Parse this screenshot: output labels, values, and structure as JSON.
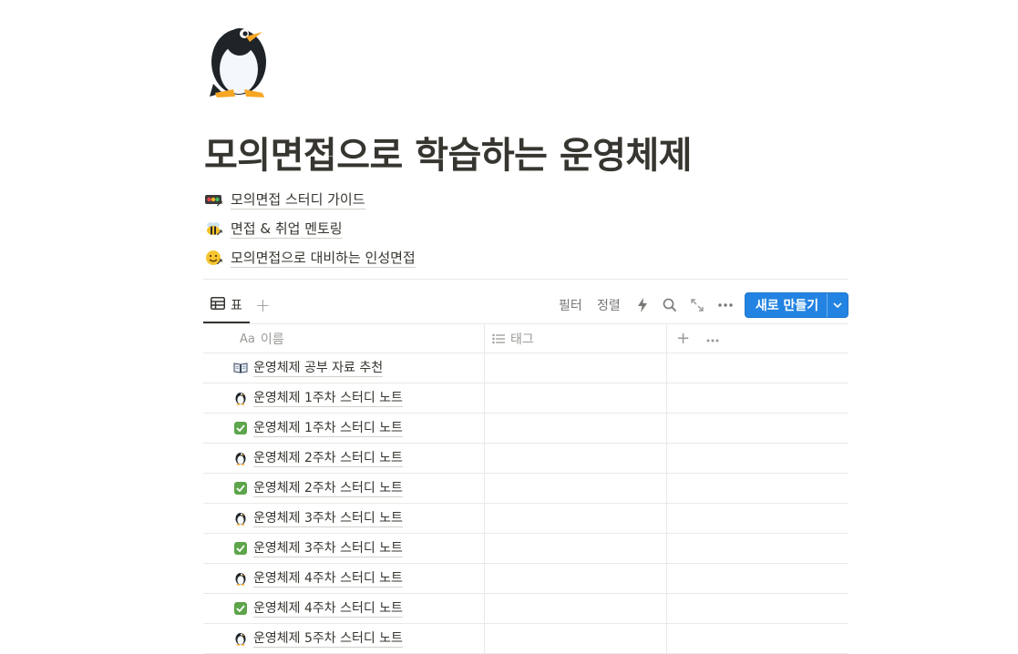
{
  "page": {
    "icon": "penguin-icon",
    "title": "모의면접으로 학습하는 운영체제"
  },
  "links": [
    {
      "icon": "traffic-light-icon",
      "label": "모의면접 스터디 가이드"
    },
    {
      "icon": "bee-icon",
      "label": "면접 & 취업 멘토링"
    },
    {
      "icon": "smile-face-icon",
      "label": "모의면접으로 대비하는 인성면접"
    }
  ],
  "toolbar": {
    "view_tab_label": "표",
    "filter_label": "필터",
    "sort_label": "정렬",
    "new_button_label": "새로 만들기"
  },
  "table": {
    "columns": {
      "name_prefix": "Aa",
      "name": "이름",
      "tag": "태그"
    },
    "rows": [
      {
        "icon": "book-icon",
        "title": "운영체제 공부 자료 추천"
      },
      {
        "icon": "penguin-icon",
        "title": "운영체제 1주차 스터디 노트"
      },
      {
        "icon": "check-icon",
        "title": "운영체제 1주차 스터디 노트"
      },
      {
        "icon": "penguin-icon",
        "title": "운영체제 2주차 스터디 노트"
      },
      {
        "icon": "check-icon",
        "title": "운영체제 2주차 스터디 노트"
      },
      {
        "icon": "penguin-icon",
        "title": "운영체제 3주차 스터디 노트"
      },
      {
        "icon": "check-icon",
        "title": "운영체제 3주차 스터디 노트"
      },
      {
        "icon": "penguin-icon",
        "title": "운영체제 4주차 스터디 노트"
      },
      {
        "icon": "check-icon",
        "title": "운영체제 4주차 스터디 노트"
      },
      {
        "icon": "penguin-icon",
        "title": "운영체제 5주차 스터디 노트"
      }
    ]
  },
  "colors": {
    "text": "#37352f",
    "muted": "#9b9a97",
    "accent": "#2383e2",
    "check": "#5da44a",
    "divider": "#e9e9e7"
  }
}
